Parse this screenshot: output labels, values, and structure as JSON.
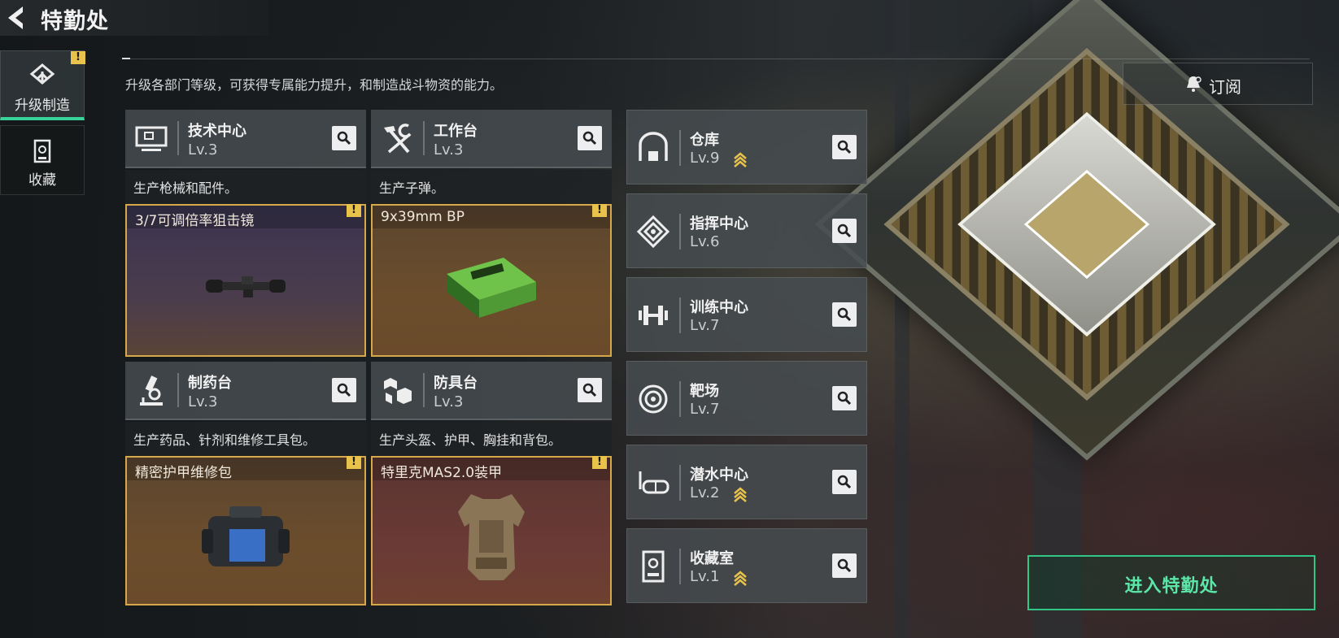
{
  "header": {
    "title": "特勤处"
  },
  "sidebar": {
    "items": [
      {
        "label": "升级制造",
        "icon": "upgrade-icon",
        "active": true,
        "alert": "!"
      },
      {
        "label": "收藏",
        "icon": "collection-icon",
        "active": false
      }
    ]
  },
  "description": "升级各部门等级，可获得专属能力提升，和制造战斗物资的能力。",
  "subscribe": {
    "label": "订阅",
    "icon": "bell-icon"
  },
  "workshops": [
    {
      "name": "技术中心",
      "level": "Lv.3",
      "desc": "生产枪械和配件。",
      "item": "3/7可调倍率狙击镜",
      "icon": "monitor-icon",
      "alert": "!"
    },
    {
      "name": "工作台",
      "level": "Lv.3",
      "desc": "生产子弹。",
      "item": "9x39mm BP",
      "icon": "tools-icon",
      "alert": "!"
    },
    {
      "name": "制药台",
      "level": "Lv.3",
      "desc": "生产药品、针剂和维修工具包。",
      "item": "精密护甲维修包",
      "icon": "microscope-icon",
      "alert": "!"
    },
    {
      "name": "防具台",
      "level": "Lv.3",
      "desc": "生产头盔、护甲、胸挂和背包。",
      "item": "特里克MAS2.0装甲",
      "icon": "armor-blocks-icon",
      "alert": "!"
    }
  ],
  "facilities": [
    {
      "name": "仓库",
      "level": "Lv.9",
      "upgradable": true,
      "icon": "warehouse-icon"
    },
    {
      "name": "指挥中心",
      "level": "Lv.6",
      "upgradable": false,
      "icon": "command-icon"
    },
    {
      "name": "训练中心",
      "level": "Lv.7",
      "upgradable": false,
      "icon": "dumbbell-icon"
    },
    {
      "name": "靶场",
      "level": "Lv.7",
      "upgradable": false,
      "icon": "target-icon"
    },
    {
      "name": "潜水中心",
      "level": "Lv.2",
      "upgradable": true,
      "icon": "diving-mask-icon"
    },
    {
      "name": "收藏室",
      "level": "Lv.1",
      "upgradable": true,
      "icon": "collection-room-icon"
    }
  ],
  "enter_button": {
    "label": "进入特勤处"
  },
  "colors": {
    "accent_green": "#31c586",
    "alert_yellow": "#e8c24a",
    "item_border": "#d6a84a"
  }
}
